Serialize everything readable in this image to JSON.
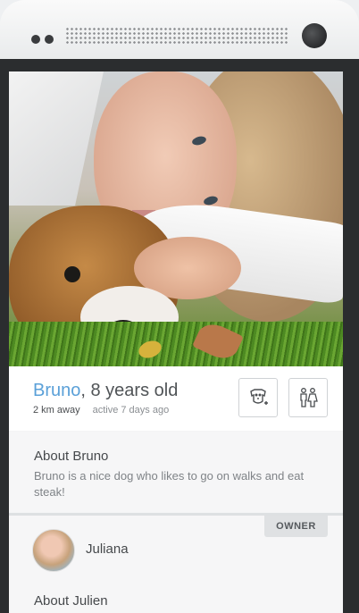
{
  "profile": {
    "dog_name": "Bruno",
    "age_text": ", 8 years old",
    "distance": "2 km away",
    "active": "active 7 days ago"
  },
  "actions": {
    "add_dog_icon": "dog-add-icon",
    "couple_icon": "couple-icon"
  },
  "about_dog": {
    "title": "About Bruno",
    "body": "Bruno is a nice dog who likes to go on walks and eat steak!"
  },
  "owner": {
    "badge": "OWNER",
    "name": "Juliana",
    "about_title": "About Julien"
  },
  "colors": {
    "accent": "#5aa0d8",
    "text": "#505457"
  }
}
